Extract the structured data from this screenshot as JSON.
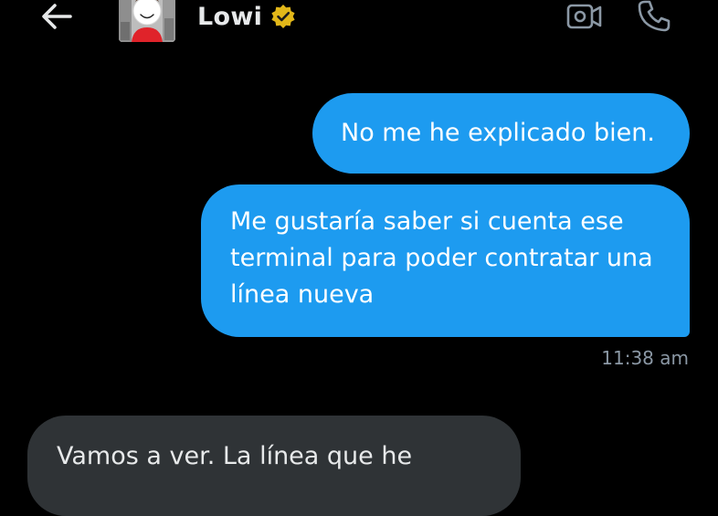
{
  "header": {
    "contact_name": "Lowi",
    "verified": true,
    "icons": {
      "back": "arrow-left-icon",
      "verified": "verified-badge-icon",
      "video": "video-call-icon",
      "call": "phone-icon"
    }
  },
  "colors": {
    "background": "#000000",
    "outgoing_bubble": "#1d9bf0",
    "incoming_bubble": "#2f3336",
    "verified_gold": "#e2b719",
    "timestamp": "#8b98a5",
    "text": "#e7e9ea"
  },
  "messages": [
    {
      "direction": "outgoing",
      "text": "No me he explicado bien."
    },
    {
      "direction": "outgoing",
      "text": "Me gustaría saber si cuenta ese terminal para poder contratar una línea nueva",
      "timestamp": "11:38 am"
    },
    {
      "direction": "incoming",
      "text": "Vamos a ver. La línea que he"
    }
  ]
}
